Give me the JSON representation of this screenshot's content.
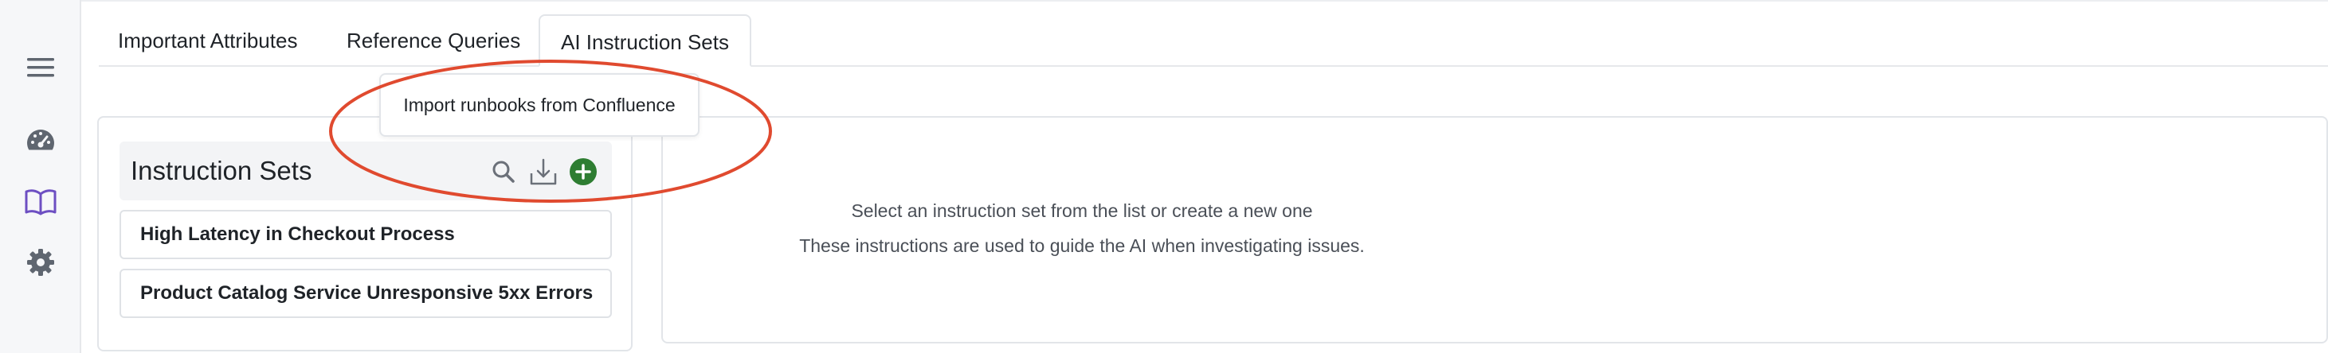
{
  "sidebar": {
    "items": [
      {
        "name": "menu-icon"
      },
      {
        "name": "dashboard-icon"
      },
      {
        "name": "book-icon",
        "active": true
      },
      {
        "name": "gear-icon"
      }
    ],
    "accent_color": "#6d4fc2",
    "icon_color": "#5f6670"
  },
  "tabs": [
    {
      "label": "Important Attributes"
    },
    {
      "label": "Reference Queries"
    },
    {
      "label": "AI Instruction Sets",
      "active": true
    }
  ],
  "instruction_sets": {
    "title": "Instruction Sets",
    "header_icons": [
      "search-icon",
      "import-icon",
      "add-icon"
    ],
    "add_color": "#2e7d32",
    "items": [
      {
        "label": "High Latency in Checkout Process"
      },
      {
        "label": "Product Catalog Service Unresponsive 5xx Errors"
      }
    ]
  },
  "tooltip": {
    "text": "Import runbooks from Confluence"
  },
  "empty_state": {
    "line1": "Select an instruction set from the list or create a new one",
    "line2": "These instructions are used to guide the AI when investigating issues."
  },
  "annotation": {
    "shape": "ellipse",
    "color": "#e04a2f"
  }
}
